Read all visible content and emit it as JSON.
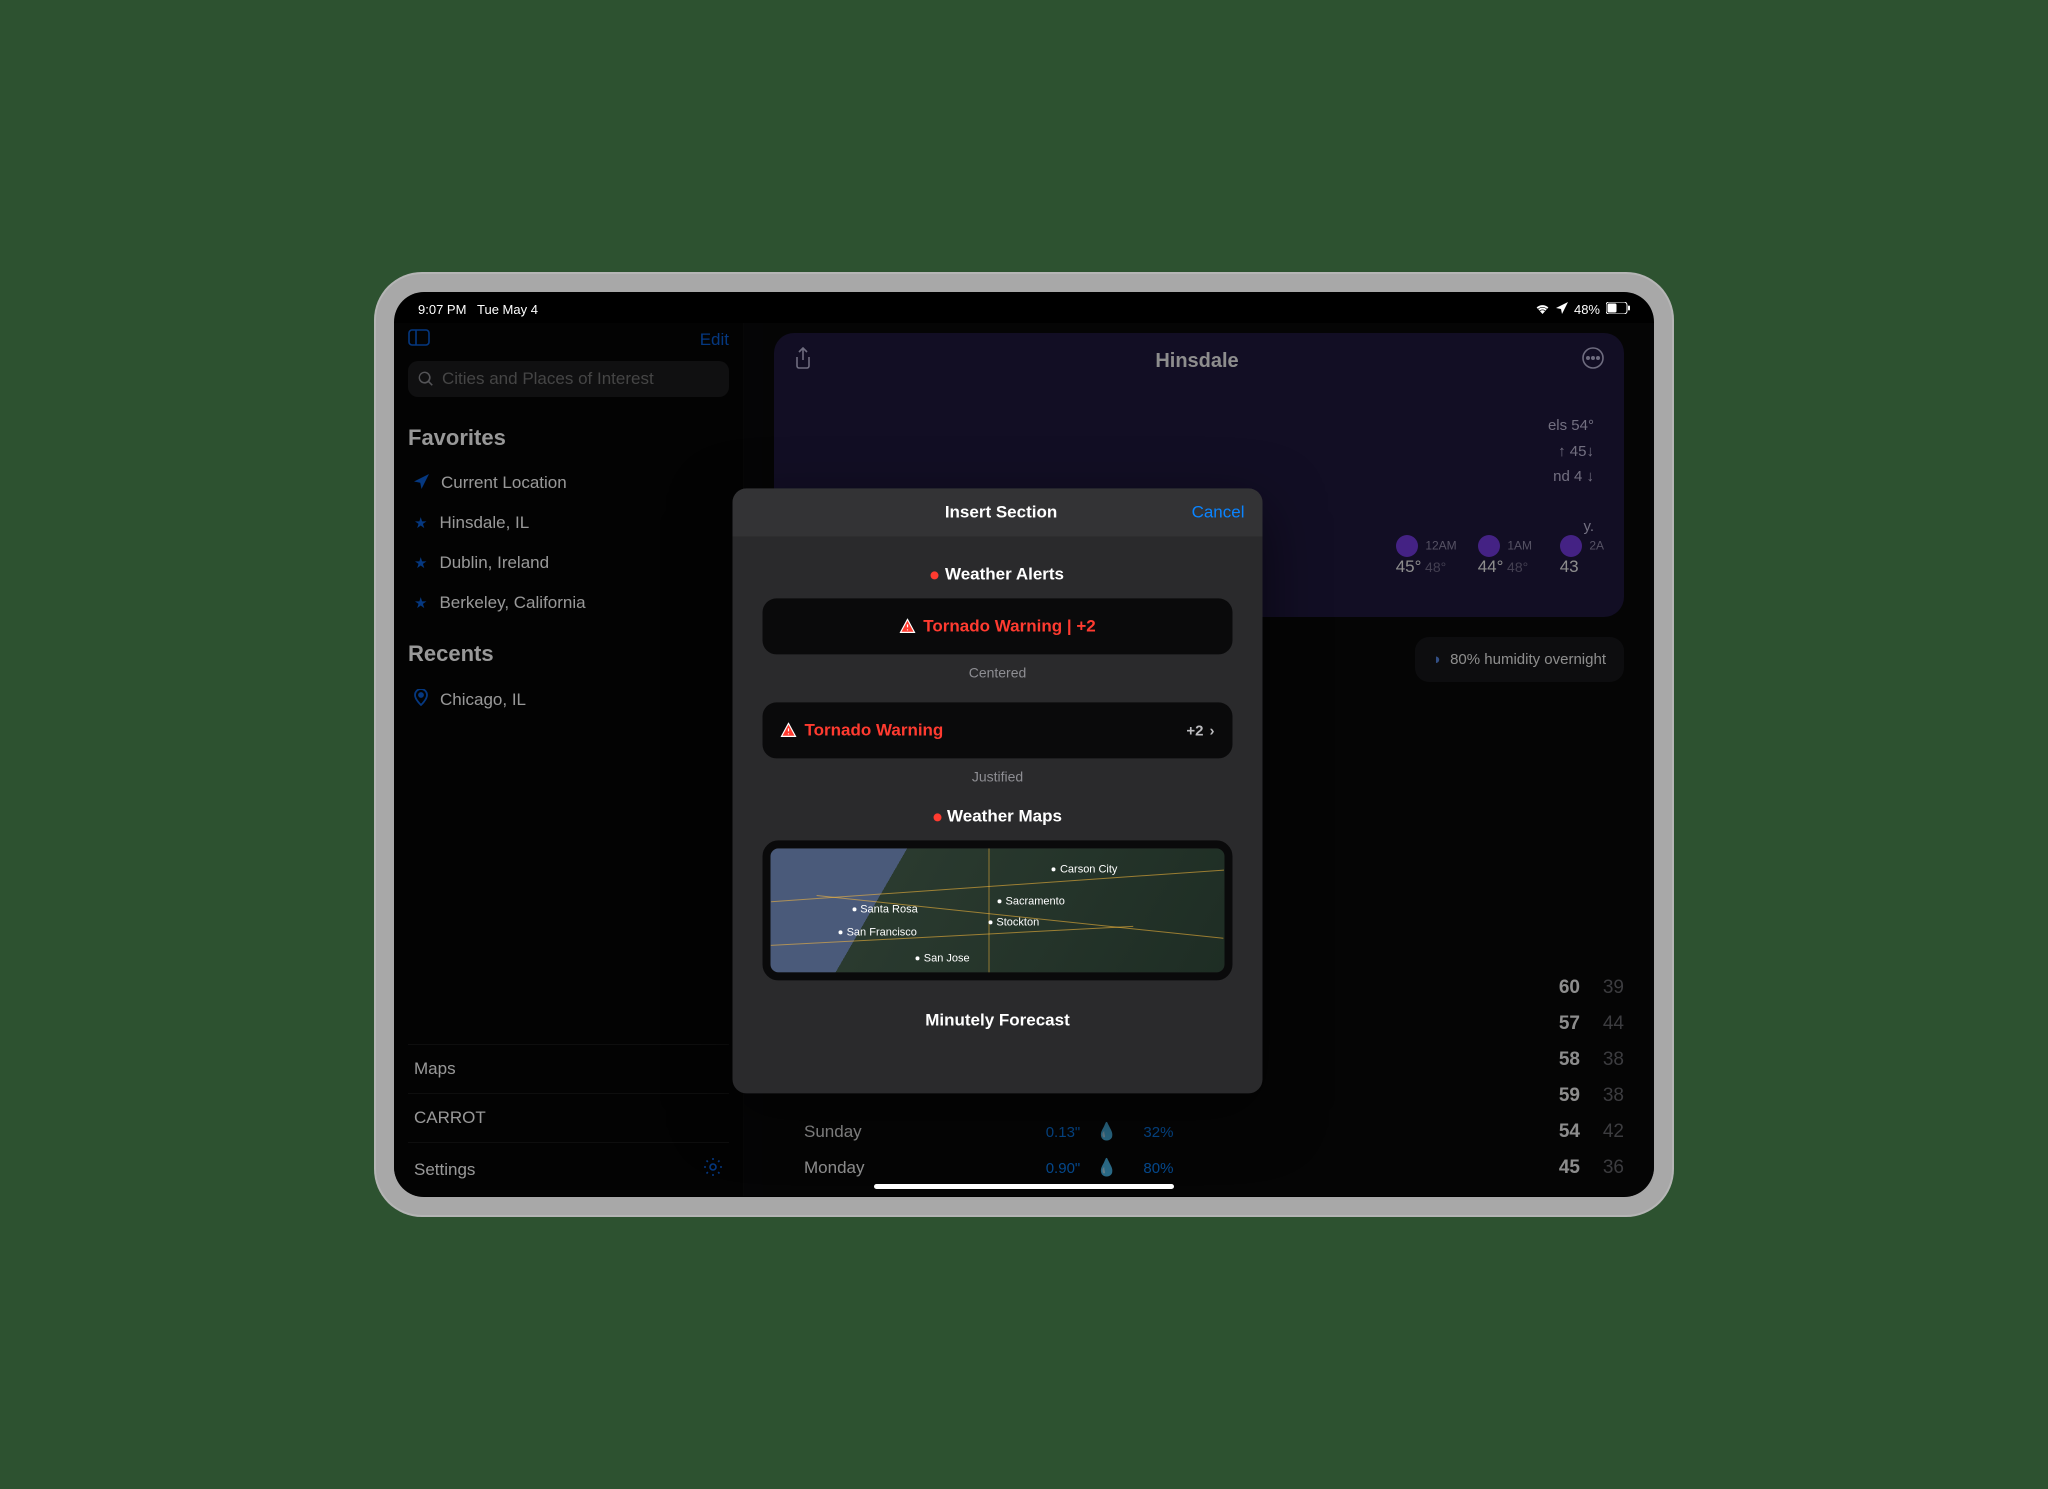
{
  "status": {
    "time": "9:07 PM",
    "date": "Tue May 4",
    "battery": "48%"
  },
  "sidebar": {
    "edit_label": "Edit",
    "search_placeholder": "Cities and Places of Interest",
    "favorites_label": "Favorites",
    "favorites": [
      {
        "label": "Current Location"
      },
      {
        "label": "Hinsdale, IL"
      },
      {
        "label": "Dublin, Ireland"
      },
      {
        "label": "Berkeley, California"
      }
    ],
    "recents_label": "Recents",
    "recents": [
      {
        "label": "Chicago, IL"
      }
    ],
    "bottom": [
      {
        "label": "Maps"
      },
      {
        "label": "CARROT"
      },
      {
        "label": "Settings"
      }
    ]
  },
  "main": {
    "location": "Hinsdale",
    "summary": [
      "els 54°",
      "↑ 45↓",
      "nd 4 ↓",
      "y."
    ],
    "hourly": [
      {
        "time": "12AM",
        "hi": "45°",
        "lo": "48°"
      },
      {
        "time": "1AM",
        "hi": "44°",
        "lo": "48°"
      },
      {
        "time": "2A",
        "hi": "43",
        "lo": ""
      }
    ],
    "humidity_card": "80% humidity overnight",
    "daily": [
      {
        "name": "",
        "precip": "",
        "pct": "",
        "hi": "60",
        "lo": "39"
      },
      {
        "name": "",
        "precip": "",
        "pct": "",
        "hi": "57",
        "lo": "44"
      },
      {
        "name": "",
        "precip": "",
        "pct": "",
        "hi": "58",
        "lo": "38"
      },
      {
        "name": "",
        "precip": "",
        "pct": "",
        "hi": "59",
        "lo": "38"
      },
      {
        "name": "Sunday",
        "precip": "0.13\"",
        "pct": "32%",
        "hi": "54",
        "lo": "42"
      },
      {
        "name": "Monday",
        "precip": "0.90\"",
        "pct": "80%",
        "hi": "45",
        "lo": "36"
      }
    ]
  },
  "modal": {
    "title": "Insert Section",
    "cancel": "Cancel",
    "weather_alerts_header": "Weather Alerts",
    "alert_centered_text": "Tornado Warning | +2",
    "centered_label": "Centered",
    "alert_justified_text": "Tornado Warning",
    "alert_justified_count": "+2",
    "justified_label": "Justified",
    "weather_maps_header": "Weather Maps",
    "map_cities": [
      "Carson City",
      "Sacramento",
      "Santa Rosa",
      "Stockton",
      "San Francisco",
      "San Jose"
    ],
    "minutely_header": "Minutely Forecast"
  }
}
